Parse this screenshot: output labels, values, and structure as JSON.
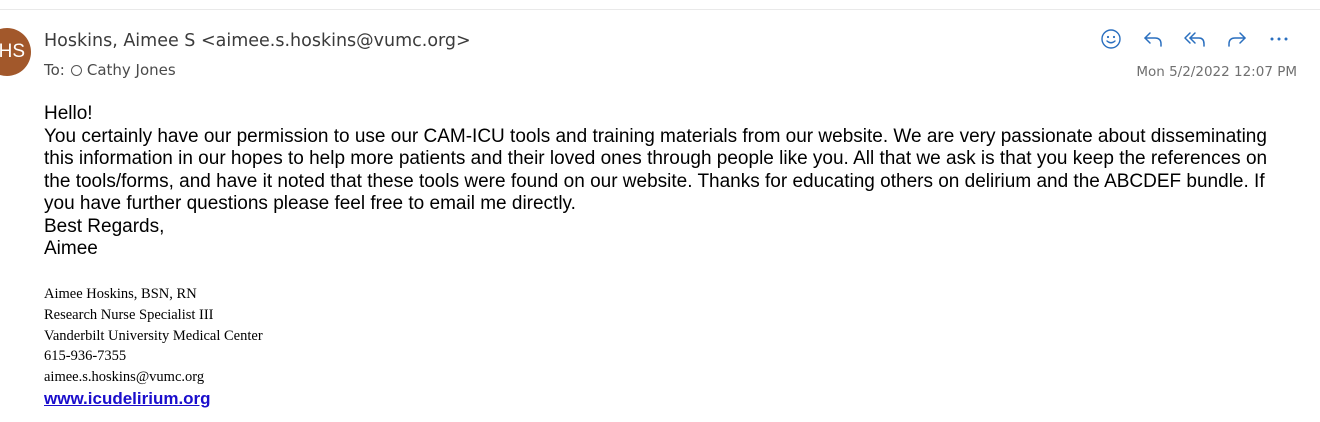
{
  "sender": {
    "initials": "HS",
    "display": "Hoskins, Aimee S <aimee.s.hoskins@vumc.org>"
  },
  "recipients": {
    "to_label": "To:",
    "names": [
      "Cathy Jones"
    ]
  },
  "timestamp": "Mon 5/2/2022 12:07 PM",
  "actions": {
    "icons": [
      "emoji-icon",
      "reply-icon",
      "reply-all-icon",
      "forward-icon",
      "more-icon"
    ]
  },
  "message": {
    "greeting": "Hello!",
    "paragraph": "You certainly have our permission to use our CAM-ICU tools and training materials from our website. We are very passionate about disseminating this information in our hopes to help more patients and their loved ones through people like you.  All that we ask is that you keep the references on the tools/forms, and have it noted that these tools were found on our website.  Thanks for educating others on delirium and the ABCDEF bundle.  If you have further questions please feel free to email me directly.",
    "closing": "Best Regards,",
    "name": "Aimee"
  },
  "signature": {
    "name_line": "Aimee Hoskins, BSN, RN",
    "title": "Research Nurse Specialist III",
    "organization": "Vanderbilt University Medical Center",
    "phone": "615-936-7355",
    "email": "aimee.s.hoskins@vumc.org",
    "website": "www.icudelirium.org"
  },
  "colors": {
    "avatar": "#a2582b",
    "action_icon": "#2a6fbf",
    "link": "#1a0dcc"
  }
}
